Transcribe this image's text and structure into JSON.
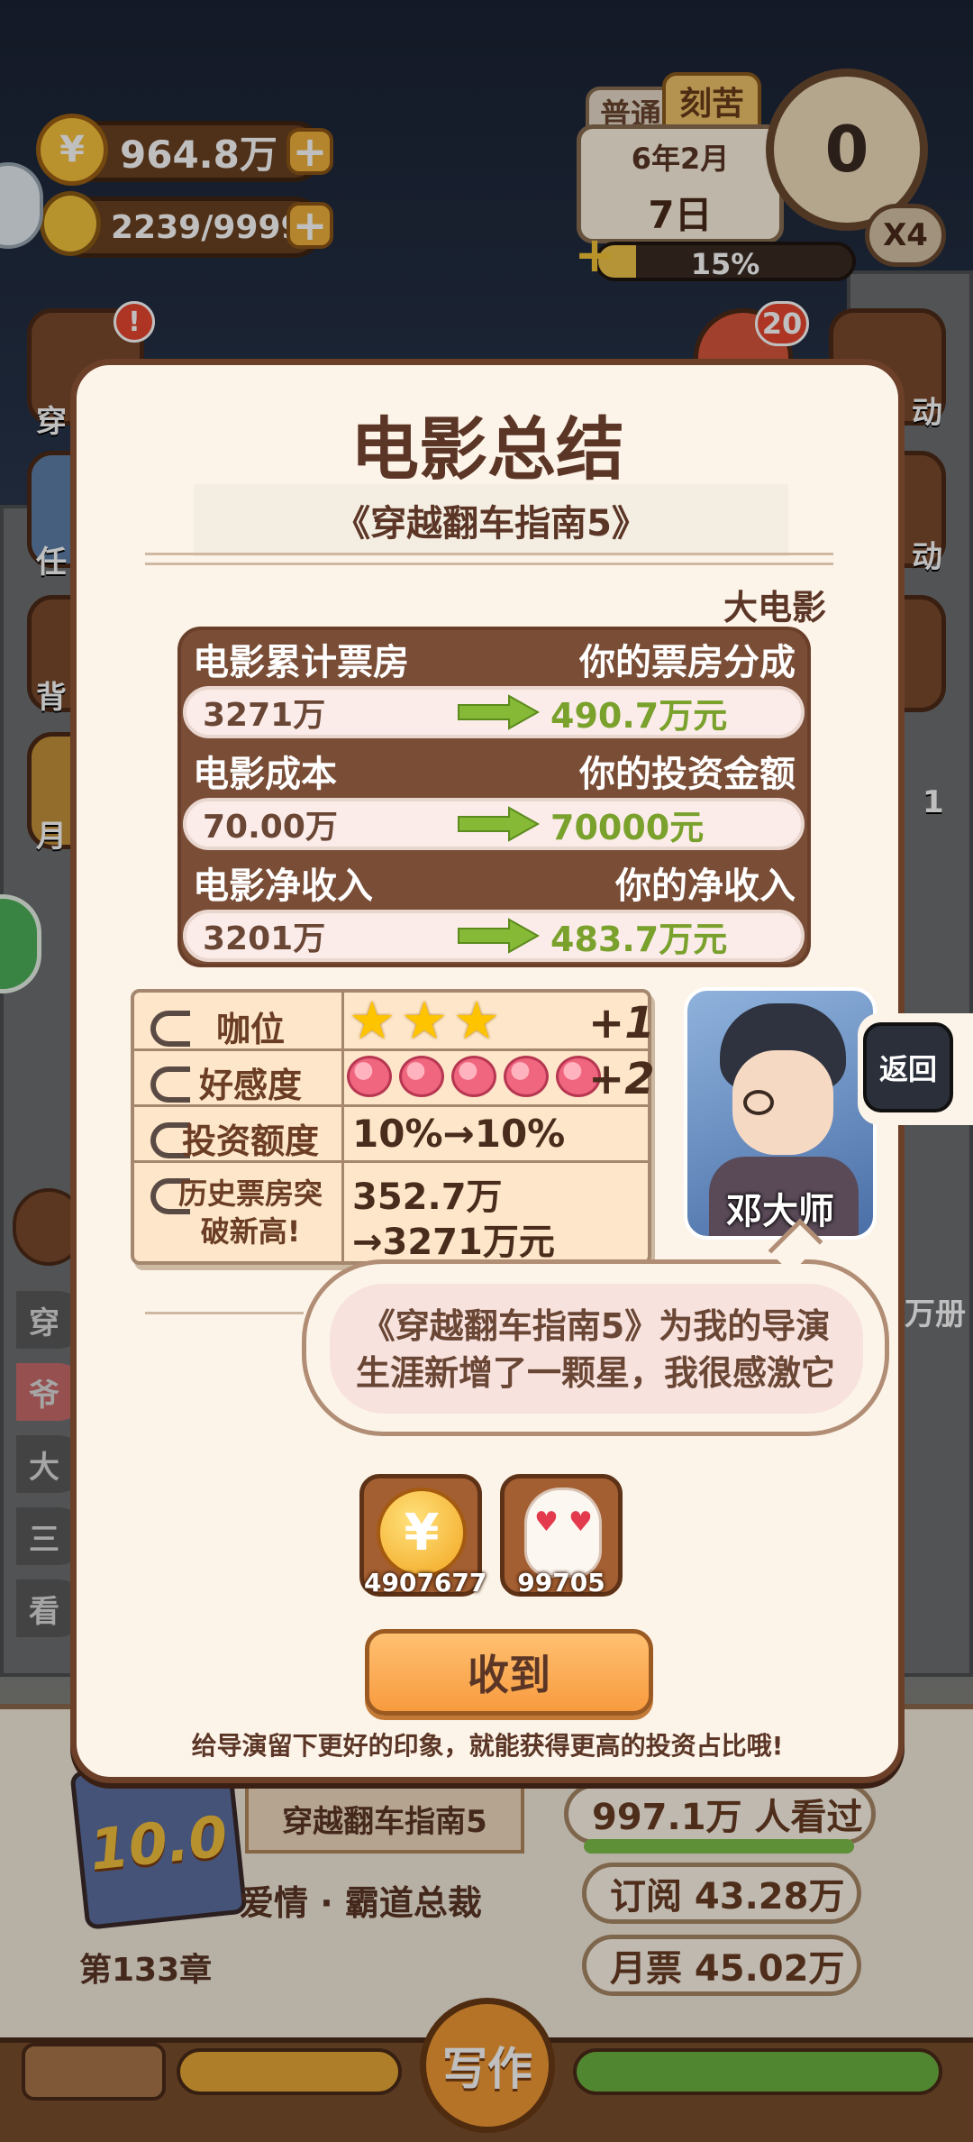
{
  "hud": {
    "coins": "964.8万",
    "energy": "2239/9999",
    "mode_tab_normal": "普通",
    "mode_tab_hard": "刻苦",
    "date_line1": "6年2月",
    "date_line2": "7日",
    "progress_label": "15%",
    "progress_fraction": 0.15,
    "counter": "0",
    "speed": "X4",
    "notify_count": "20",
    "side_left_labels": [
      "穿",
      "任",
      "背",
      "月"
    ],
    "side_right_labels": [
      "动",
      "动",
      "1"
    ]
  },
  "story_tabs": [
    "穿",
    "爷",
    "大",
    "三",
    "看"
  ],
  "dialog": {
    "title": "电影总结",
    "movie_name": "《穿越翻车指南5》",
    "category": "大电影",
    "table": [
      {
        "left_header": "电影累计票房",
        "right_header": "你的票房分成",
        "left_value": "3271万",
        "right_value": "490.7万元"
      },
      {
        "left_header": "电影成本",
        "right_header": "你的投资金额",
        "left_value": "70.00万",
        "right_value": "70000元"
      },
      {
        "left_header": "电影净收入",
        "right_header": "你的净收入",
        "left_value": "3201万",
        "right_value": "483.7万元"
      }
    ],
    "notes": {
      "rank_label": "咖位",
      "rank_stars": 3,
      "rank_bonus": "+1",
      "favor_label": "好感度",
      "favor_hearts": 5,
      "favor_bonus": "+2",
      "invest_label": "投资额度",
      "invest_value": "10%→10%",
      "record_label_1": "历史票房突",
      "record_label_2": "破新高!",
      "record_value_1": "352.7万",
      "record_value_2": "→3271万元"
    },
    "director_name": "邓大师",
    "back_button": "返回",
    "speech_line1": "《穿越翻车指南5》为我的导演",
    "speech_line2": "生涯新增了一颗星，我很感激它",
    "rewards": [
      {
        "icon": "coin-icon",
        "amount": "4907677"
      },
      {
        "icon": "love-icon",
        "amount": "99705"
      }
    ],
    "confirm_button": "收到",
    "tip": "给导演留下更好的印象，就能获得更高的投资占比哦!"
  },
  "book": {
    "score": "10.0",
    "title": "穿越翻车指南5",
    "genre": "爱情 · 霸道总裁",
    "chapter": "第133章",
    "views": "997.1万 人看过",
    "subscribe": "订阅 43.28万",
    "monthly": "月票 45.02万",
    "write_button": "写作",
    "side_text": "万册"
  }
}
